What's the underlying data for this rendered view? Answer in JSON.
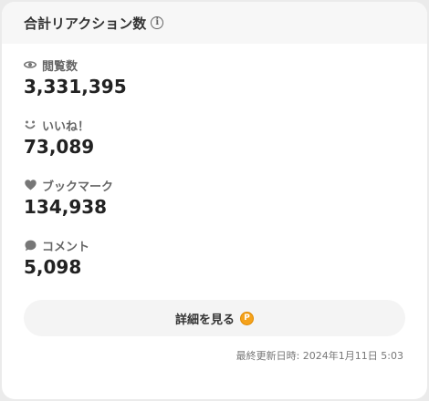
{
  "header": {
    "title": "合計リアクション数",
    "info_icon_glyph": "i"
  },
  "stats": [
    {
      "icon": "eye-icon",
      "label": "閲覧数",
      "value": "3,331,395"
    },
    {
      "icon": "smile-icon",
      "label": "いいね！",
      "value": "73,089"
    },
    {
      "icon": "heart-icon",
      "label": "ブックマーク",
      "value": "134,938"
    },
    {
      "icon": "comment-icon",
      "label": "コメント",
      "value": "5,098"
    }
  ],
  "detail_button": {
    "label": "詳細を見る",
    "badge": "P",
    "badge_color": "#f5a21b"
  },
  "footer": {
    "updated": "最終更新日時: 2024年1月11日 5:03"
  },
  "colors": {
    "header_bg": "#f7f7f7",
    "icon_gray": "#777777",
    "value_text": "#222222"
  }
}
